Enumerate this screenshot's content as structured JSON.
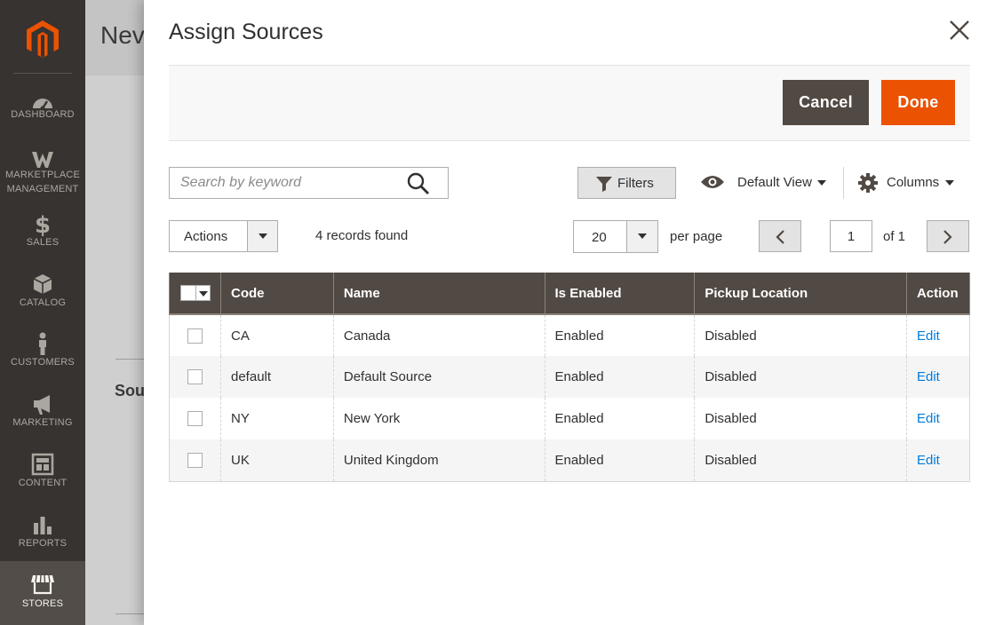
{
  "sidebar": {
    "items": [
      {
        "label": "Dashboard"
      },
      {
        "label": "Marketplace Management"
      },
      {
        "label": "Sales"
      },
      {
        "label": "Catalog"
      },
      {
        "label": "Customers"
      },
      {
        "label": "Marketing"
      },
      {
        "label": "Content"
      },
      {
        "label": "Reports"
      },
      {
        "label": "Stores"
      }
    ],
    "active_index": 8
  },
  "underpage": {
    "title": "Nev",
    "section_title": "Sou"
  },
  "modal": {
    "title": "Assign Sources",
    "cancel_label": "Cancel",
    "done_label": "Done"
  },
  "toolbar": {
    "search_placeholder": "Search by keyword",
    "filters_label": "Filters",
    "view_label": "Default View",
    "columns_label": "Columns",
    "actions_label": "Actions",
    "records_found": "4 records found",
    "per_page_value": "20",
    "per_page_label": "per page",
    "current_page": "1",
    "total_pages_label": "of 1"
  },
  "grid": {
    "columns": [
      "Code",
      "Name",
      "Is Enabled",
      "Pickup Location",
      "Action"
    ],
    "rows": [
      {
        "code": "CA",
        "name": "Canada",
        "enabled": "Enabled",
        "pickup": "Disabled",
        "action": "Edit"
      },
      {
        "code": "default",
        "name": "Default Source",
        "enabled": "Enabled",
        "pickup": "Disabled",
        "action": "Edit"
      },
      {
        "code": "NY",
        "name": "New York",
        "enabled": "Enabled",
        "pickup": "Disabled",
        "action": "Edit"
      },
      {
        "code": "UK",
        "name": "United Kingdom",
        "enabled": "Enabled",
        "pickup": "Disabled",
        "action": "Edit"
      }
    ]
  },
  "colors": {
    "sidebar_bg": "#373330",
    "accent_orange": "#eb5202",
    "header_brown": "#514943",
    "link_blue": "#007bdb"
  },
  "icons": [
    "magento-logo-icon",
    "dashboard-icon",
    "marketplace-icon",
    "dollar-icon",
    "cube-icon",
    "person-icon",
    "megaphone-icon",
    "content-icon",
    "bar-chart-icon",
    "store-icon",
    "close-icon",
    "search-icon",
    "filter-icon",
    "eye-icon",
    "gear-icon",
    "chevron-left-icon",
    "chevron-right-icon"
  ]
}
